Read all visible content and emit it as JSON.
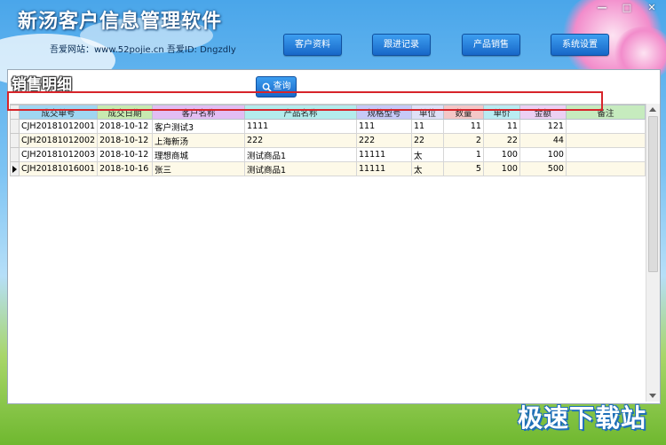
{
  "window": {
    "title": "新汤客户信息管理软件",
    "subtitle": "吾爱网站：www.52pojie.cn  吾爱ID: Dngzdly",
    "controls": [
      "—",
      "□",
      "✕"
    ]
  },
  "nav": {
    "buttons": [
      "客户资料",
      "跟进记录",
      "产品销售",
      "系统设置"
    ]
  },
  "panel": {
    "title": "销售明细",
    "query_label": "查询"
  },
  "grid": {
    "columns": [
      {
        "label": "成交单号",
        "color": "#9fd6f2"
      },
      {
        "label": "成交日期",
        "color": "#c7eab0"
      },
      {
        "label": "客户名称",
        "color": "#e2bdf3"
      },
      {
        "label": "产品名称",
        "color": "#b3ecec"
      },
      {
        "label": "规格型号",
        "color": "#c6c9f7"
      },
      {
        "label": "单位",
        "color": "#dfe0f7"
      },
      {
        "label": "数量",
        "color": "#f4c7c7"
      },
      {
        "label": "单价",
        "color": "#b9ecf2"
      },
      {
        "label": "金额",
        "color": "#ecd0f3"
      },
      {
        "label": "备注",
        "color": "#c6ebbe"
      }
    ],
    "rows": [
      [
        "CJH20181012001",
        "2018-10-12",
        "客户测试3",
        "1111",
        "111",
        "11",
        "11",
        "11",
        "121",
        ""
      ],
      [
        "CJH20181012002",
        "2018-10-12",
        "上海新汤",
        "222",
        "222",
        "22",
        "2",
        "22",
        "44",
        ""
      ],
      [
        "CJH20181012003",
        "2018-10-12",
        "理想商城",
        "测试商品1",
        "11111",
        "太",
        "1",
        "100",
        "100",
        ""
      ],
      [
        "CJH20181016001",
        "2018-10-16",
        "张三",
        "测试商品1",
        "11111",
        "太",
        "5",
        "100",
        "500",
        ""
      ]
    ],
    "current_row": 3
  },
  "watermark": "极速下载站",
  "colors": {
    "accent_button": "#1767c8",
    "highlight_border": "#d7242a"
  }
}
